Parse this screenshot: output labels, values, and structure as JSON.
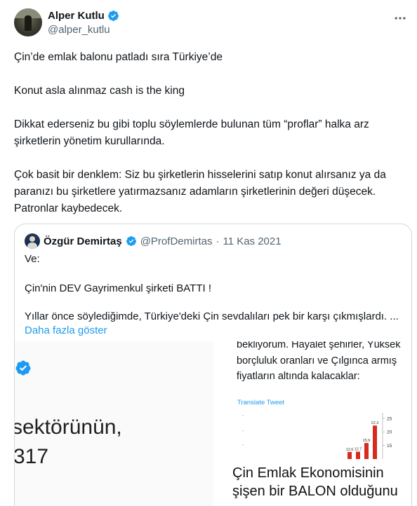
{
  "author": {
    "name": "Alper Kutlu",
    "handle": "@alper_kutlu"
  },
  "tweet": {
    "p1": "Çin’de emlak balonu patladı sıra Türkiye’de",
    "p2": "Konut asla alınmaz cash is the king",
    "p3": "Dikkat ederseniz bu gibi toplu söylemlerde bulunan tüm “proflar” halka arz şirketlerin yönetim kurullarında.",
    "p4": "Çok basit bir denklem: Siz bu şirketlerin hisselerini satıp konut alırsanız ya da paranızı bu şirketlere yatırmazsanız adamların şirketlerinin değeri düşecek. Patronlar kaybedecek."
  },
  "quote": {
    "name": "Özgür Demirtaş",
    "handle": "@ProfDemirtas",
    "separator": "·",
    "date": "11 Kas 2021",
    "line1": "Ve:",
    "line2": "Çin'nin DEV Gayrimenkul şirketi BATTI !",
    "line3": "Yıllar önce söylediğimde, Türkiye'deki Çin sevdalıları pek bir karşı çıkmışlardı. ...",
    "show_more": "Daha fazla göster"
  },
  "media_left": {
    "text1": "sektörünün,",
    "text2": "317",
    "text3": "·····  ··· · ····· ·"
  },
  "media_right": {
    "line1": "bekliyorum. Hayalet şehirler, Yüksek",
    "line2": "borçluluk oranları ve Çılgınca armış",
    "line3": "fiyatların altında kalacaklar:",
    "translate": "Translate Tweet",
    "big1": "Çin Emlak Ekonomisinin",
    "big2": "şişen bir BALON olduğunu"
  },
  "chart_data": {
    "type": "bar",
    "categories": [
      "1",
      "2",
      "3",
      "4"
    ],
    "values": [
      12.6,
      12.7,
      15.9,
      22.3
    ],
    "data_labels": [
      "12.6",
      "12.7",
      "15.9",
      "22.3"
    ],
    "y_ticks": [
      "25",
      "20",
      "15"
    ],
    "ylim": [
      10,
      27
    ],
    "colors": {
      "bar": "#d62b1f"
    }
  },
  "colors": {
    "verified": "#1d9bf0",
    "link": "#1d9bf0",
    "border": "#cfd9de",
    "muted": "#536471"
  }
}
